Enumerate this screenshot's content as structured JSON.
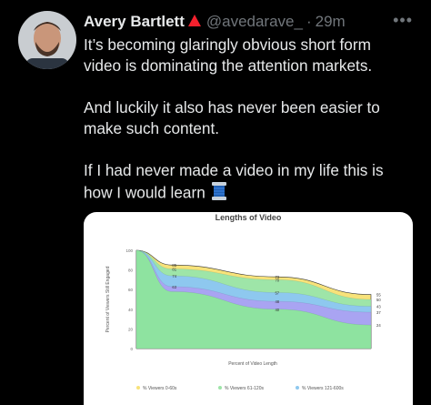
{
  "tweet": {
    "author_name": "Avery Bartlett",
    "handle": "@avedarave_",
    "separator": "·",
    "time": "29m",
    "more": "•••",
    "avatar_icon": "avatar-photo",
    "flag_icon": "red-triangle-icon",
    "lines": [
      "It’s becoming glaringly obvious short form",
      "video is dominating the attention markets.",
      "",
      "And luckily it also has never been easier to",
      "make such content.",
      "",
      "If I had never made a video in my life this is",
      "how I would learn"
    ],
    "emoji": "spool-of-thread"
  },
  "chart_data": {
    "type": "area",
    "title": "Lengths of Video",
    "xlabel": "Percent of Video Length",
    "ylabel": "Percent of Viewers Still Engaged",
    "ylim": [
      0,
      100
    ],
    "yticks": [
      "100",
      "80",
      "60",
      "40",
      "20",
      "0"
    ],
    "x": [
      0,
      0.15,
      0.6,
      1
    ],
    "series": [
      {
        "name": "% Viewers 0-60s",
        "color": "#f7e27a",
        "values": [
          100,
          85,
          73,
          55
        ],
        "labels": [
          "85",
          "73",
          "55"
        ]
      },
      {
        "name": "% Viewers 61-120s",
        "color": "#9ee5a8",
        "values": [
          100,
          81,
          70,
          50
        ],
        "labels": [
          "81",
          "70",
          "50"
        ]
      },
      {
        "name": "% Viewers 121-600s",
        "color": "#8ec8ef",
        "values": [
          100,
          74,
          57,
          43
        ],
        "labels": [
          "74",
          "57",
          "43"
        ]
      },
      {
        "name": "",
        "color": "#a9a4f2",
        "values": [
          100,
          63,
          48,
          37
        ],
        "labels": [
          "63",
          "48",
          "37"
        ]
      },
      {
        "name": "",
        "color": "#8ee3a0",
        "values": [
          100,
          58,
          40,
          24
        ],
        "labels": [
          "",
          "40",
          "24"
        ]
      }
    ],
    "legend_position": "bottom"
  }
}
